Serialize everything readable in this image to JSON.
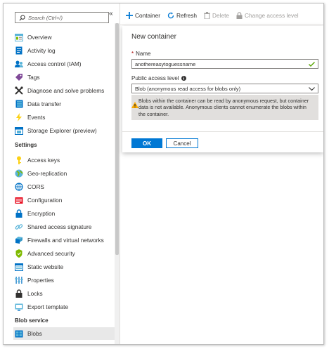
{
  "search": {
    "placeholder": "Search (Ctrl+/)"
  },
  "sidebar": {
    "items": [
      {
        "label": "Overview",
        "icon": "overview-icon"
      },
      {
        "label": "Activity log",
        "icon": "activity-log-icon"
      },
      {
        "label": "Access control (IAM)",
        "icon": "access-control-icon"
      },
      {
        "label": "Tags",
        "icon": "tag-icon"
      },
      {
        "label": "Diagnose and solve problems",
        "icon": "wrench-icon"
      },
      {
        "label": "Data transfer",
        "icon": "data-transfer-icon"
      },
      {
        "label": "Events",
        "icon": "lightning-icon"
      },
      {
        "label": "Storage Explorer (preview)",
        "icon": "storage-explorer-icon"
      }
    ],
    "settings_header": "Settings",
    "settings_items": [
      {
        "label": "Access keys",
        "icon": "key-icon"
      },
      {
        "label": "Geo-replication",
        "icon": "globe-icon"
      },
      {
        "label": "CORS",
        "icon": "cors-icon"
      },
      {
        "label": "Configuration",
        "icon": "configuration-icon"
      },
      {
        "label": "Encryption",
        "icon": "lock-icon"
      },
      {
        "label": "Shared access signature",
        "icon": "link-icon"
      },
      {
        "label": "Firewalls and virtual networks",
        "icon": "firewall-icon"
      },
      {
        "label": "Advanced security",
        "icon": "shield-icon"
      },
      {
        "label": "Static website",
        "icon": "static-website-icon"
      },
      {
        "label": "Properties",
        "icon": "properties-icon"
      },
      {
        "label": "Locks",
        "icon": "padlock-icon"
      },
      {
        "label": "Export template",
        "icon": "export-template-icon"
      }
    ],
    "blob_header": "Blob service",
    "blob_items": [
      {
        "label": "Blobs",
        "icon": "blobs-icon"
      }
    ]
  },
  "toolbar": {
    "container": "Container",
    "refresh": "Refresh",
    "delete": "Delete",
    "change_access": "Change access level"
  },
  "panel": {
    "title": "New container",
    "name_label": "Name",
    "name_value": "anothereasytoguessname",
    "access_label": "Public access level",
    "access_value": "Blob (anonymous read access for blobs only)",
    "warning": "Blobs within the container can be read by anonymous request, but container data is not available. Anonymous clients cannot enumerate the blobs within the container.",
    "ok": "OK",
    "cancel": "Cancel"
  },
  "colors": {
    "accent": "#0078d4",
    "valid": "#57a300",
    "warning": "#f7a700"
  }
}
